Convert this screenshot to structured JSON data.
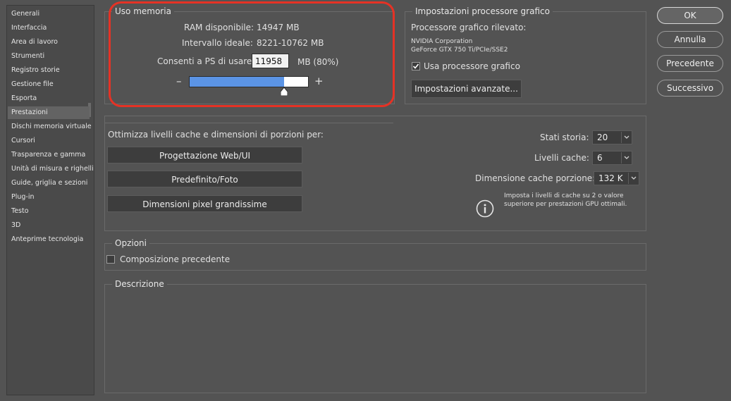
{
  "sidebar": {
    "items": [
      {
        "label": "Generali"
      },
      {
        "label": "Interfaccia"
      },
      {
        "label": "Area di lavoro"
      },
      {
        "label": "Strumenti"
      },
      {
        "label": "Registro storie"
      },
      {
        "label": "Gestione file"
      },
      {
        "label": "Esporta"
      },
      {
        "label": "Prestazioni"
      },
      {
        "label": "Dischi memoria virtuale"
      },
      {
        "label": "Cursori"
      },
      {
        "label": "Trasparenza e gamma"
      },
      {
        "label": "Unità di misura e righelli"
      },
      {
        "label": "Guide, griglia e sezioni"
      },
      {
        "label": "Plug-in"
      },
      {
        "label": "Testo"
      },
      {
        "label": "3D"
      },
      {
        "label": "Anteprime tecnologia"
      }
    ],
    "active_index": 7
  },
  "memory": {
    "title": "Uso memoria",
    "ram_label": "RAM disponibile:",
    "ram_value": "14947 MB",
    "ideal_label": "Intervallo ideale:",
    "ideal_value": "8221-10762 MB",
    "allow_label": "Consenti a PS di usare:",
    "allow_value": "11958",
    "allow_suffix": "MB (80%)",
    "minus": "–",
    "plus": "+",
    "slider_fraction": 0.8
  },
  "gpu": {
    "title": "Impostazioni processore grafico",
    "detected_label": "Processore grafico rilevato:",
    "vendor": "NVIDIA Corporation",
    "model": "GeForce GTX 750 Ti/PCIe/SSE2",
    "use_gpu_label": "Usa processore grafico",
    "use_gpu_checked": true,
    "advanced_button": "Impostazioni avanzate..."
  },
  "cache": {
    "optimize_label": "Ottimizza livelli cache e dimensioni di porzioni per:",
    "preset_web": "Progettazione Web/UI",
    "preset_default": "Predefinito/Foto",
    "preset_huge": "Dimensioni pixel grandissime",
    "history_label": "Stati storia:",
    "history_value": "20",
    "levels_label": "Livelli cache:",
    "levels_value": "6",
    "tile_label": "Dimensione cache porzione:",
    "tile_value": "132 K",
    "info_line1": "Imposta i livelli di cache su 2 o valore",
    "info_line2": "superiore per prestazioni GPU ottimali."
  },
  "options": {
    "title": "Opzioni",
    "legacy_label": "Composizione precedente",
    "legacy_checked": false
  },
  "description": {
    "title": "Descrizione"
  },
  "buttons": {
    "ok": "OK",
    "cancel": "Annulla",
    "prev": "Precedente",
    "next": "Successivo"
  },
  "colors": {
    "accent_ring": "#e53225",
    "slider_fill": "#5b94e5"
  }
}
